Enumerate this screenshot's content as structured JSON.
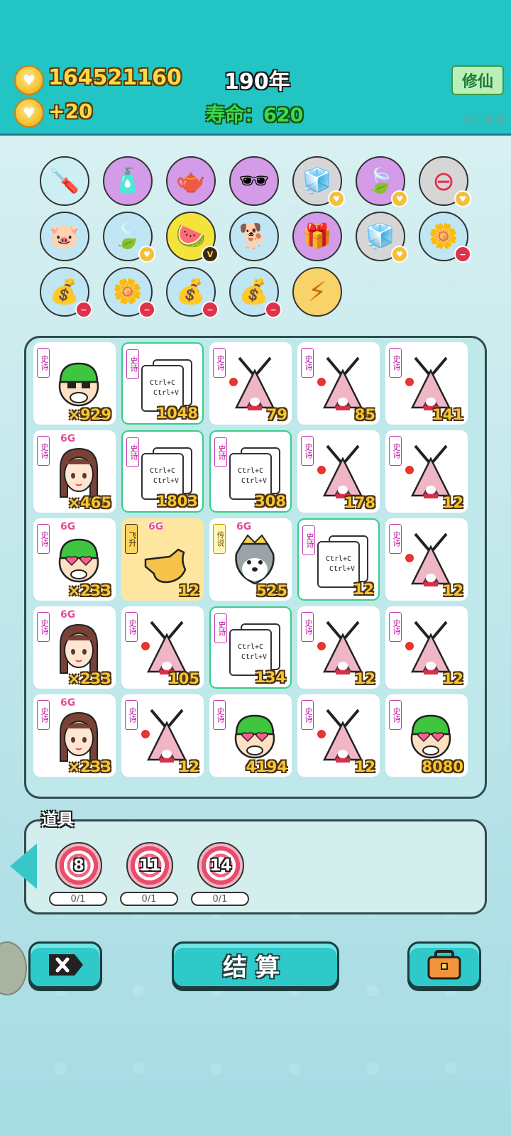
{
  "header": {
    "coins": "164521160",
    "income": "+20",
    "year": "190年",
    "life_label": "寿命：",
    "life_value": "620",
    "xiuxian_button": "修仙",
    "version": "v1.9.9"
  },
  "items_row1": [
    "screwdriver-icon",
    "spray-bottle-icon",
    "gravy-boat-icon",
    "sunglasses-peach-icon",
    "sugar-cubes-icon",
    "leaf-icon",
    "no-entry-icon"
  ],
  "items_row2": [
    "piggy-bank-icon",
    "leaf-icon",
    "fruit-basket-icon",
    "dog-sunglasses-icon",
    "purple-box-icon",
    "sugar-cubes-icon",
    "potted-flower-icon"
  ],
  "items_row3": [
    "money-bag-icon",
    "potted-flower-icon",
    "money-bag-icon",
    "money-bag-icon",
    "lightning-icon"
  ],
  "board": {
    "cards": [
      {
        "tag": "史诗",
        "badge": "",
        "count": "×929",
        "art": "guy-mask"
      },
      {
        "tag": "史诗",
        "badge": "",
        "count": "1048",
        "art": "ctrl-paper",
        "paper": [
          "Ctrl+C",
          "Ctrl+V"
        ]
      },
      {
        "tag": "史诗",
        "badge": "",
        "count": "79",
        "art": "rabbit-tent"
      },
      {
        "tag": "史诗",
        "badge": "",
        "count": "85",
        "art": "rabbit-tent"
      },
      {
        "tag": "史诗",
        "badge": "",
        "count": "141",
        "art": "rabbit-tent"
      },
      {
        "tag": "史诗",
        "badge": "6G",
        "count": "×465",
        "art": "girl"
      },
      {
        "tag": "史诗",
        "badge": "",
        "count": "1803",
        "art": "ctrl-paper",
        "paper": [
          "Ctrl+C",
          "Ctrl+V"
        ]
      },
      {
        "tag": "史诗",
        "badge": "",
        "count": "308",
        "art": "ctrl-paper",
        "paper": [
          "Ctrl+C",
          "Ctrl+V"
        ]
      },
      {
        "tag": "史诗",
        "badge": "",
        "count": "178",
        "art": "rabbit-tent"
      },
      {
        "tag": "史诗",
        "badge": "",
        "count": "12",
        "art": "rabbit-tent"
      },
      {
        "tag": "史诗",
        "badge": "6G",
        "count": "×233",
        "art": "guy-hearts"
      },
      {
        "tag": "飞升",
        "badge": "6G",
        "count": "12",
        "art": "hand"
      },
      {
        "tag": "传说",
        "badge": "6G",
        "count": "525",
        "art": "husky-crown"
      },
      {
        "tag": "史诗",
        "badge": "",
        "count": "12",
        "art": "ctrl-paper",
        "paper": [
          "Ctrl+C",
          "Ctrl+V"
        ]
      },
      {
        "tag": "史诗",
        "badge": "",
        "count": "12",
        "art": "rabbit-tent"
      },
      {
        "tag": "史诗",
        "badge": "6G",
        "count": "×233",
        "art": "girl"
      },
      {
        "tag": "史诗",
        "badge": "",
        "count": "105",
        "art": "rabbit-tent"
      },
      {
        "tag": "史诗",
        "badge": "",
        "count": "134",
        "art": "ctrl-paper",
        "paper": [
          "Ctrl+C",
          "Ctrl+V"
        ]
      },
      {
        "tag": "史诗",
        "badge": "",
        "count": "12",
        "art": "rabbit-tent"
      },
      {
        "tag": "史诗",
        "badge": "",
        "count": "12",
        "art": "rabbit-tent"
      },
      {
        "tag": "史诗",
        "badge": "6G",
        "count": "×233",
        "art": "girl"
      },
      {
        "tag": "史诗",
        "badge": "",
        "count": "12",
        "art": "rabbit-tent"
      },
      {
        "tag": "史诗",
        "badge": "",
        "count": "4194",
        "art": "guy-hearts"
      },
      {
        "tag": "史诗",
        "badge": "",
        "count": "12",
        "art": "rabbit-tent"
      },
      {
        "tag": "史诗",
        "badge": "",
        "count": "8080",
        "art": "guy-hearts"
      }
    ]
  },
  "props": {
    "label": "道具",
    "items": [
      {
        "value": "8",
        "progress": "0/1"
      },
      {
        "value": "11",
        "progress": "0/1"
      },
      {
        "value": "14",
        "progress": "0/1"
      }
    ]
  },
  "buttons": {
    "settle": "结算"
  },
  "colors": {
    "header": "#22c4c4",
    "accent": "#2fc9c9",
    "coin_text": "#ffd84a",
    "life_text": "#3bd94b"
  }
}
